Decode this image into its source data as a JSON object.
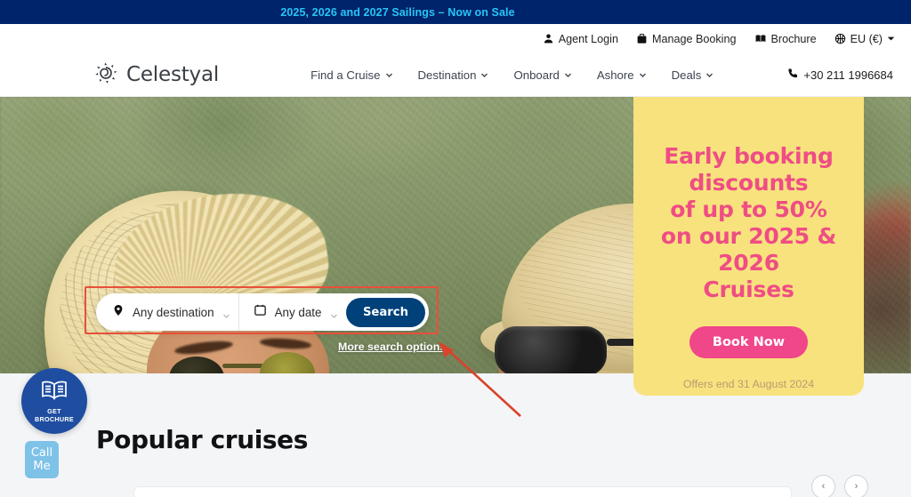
{
  "promo_banner": {
    "text": "2025, 2026 and 2027 Sailings – Now on Sale",
    "bg_color": "#00246b",
    "text_color": "#29c5f6"
  },
  "utility_bar": {
    "items": [
      {
        "label": "Agent Login",
        "icon": "user-icon"
      },
      {
        "label": "Manage Booking",
        "icon": "suitcase-icon"
      },
      {
        "label": "Brochure",
        "icon": "book-icon"
      },
      {
        "label": "EU (€)",
        "icon": "globe-icon"
      }
    ]
  },
  "header": {
    "logo_text": "Celestyal",
    "logo_icon": "sun-swirl-icon",
    "nav": [
      {
        "label": "Find a Cruise"
      },
      {
        "label": "Destination"
      },
      {
        "label": "Onboard"
      },
      {
        "label": "Ashore"
      },
      {
        "label": "Deals"
      }
    ],
    "phone": "+30 211 1996684",
    "phone_icon": "phone-icon"
  },
  "hero": {
    "search": {
      "destination_value": "Any destination",
      "destination_icon": "map-pin-icon",
      "date_value": "Any date",
      "date_icon": "calendar-icon",
      "search_button": "Search",
      "more_options": "More search options"
    },
    "promo_panel": {
      "heading_line1": "Early booking",
      "heading_line2": "discounts",
      "heading_line3": "of up to 50%",
      "heading_line4": "on our 2025 & 2026",
      "heading_line5": "Cruises",
      "button": "Book Now",
      "note": "Offers end 31 August 2024",
      "bg_color": "#f7e27e",
      "heading_color": "#ef4d84",
      "button_color": "#f0468a"
    }
  },
  "floating": {
    "brochure": {
      "line1": "GET",
      "line2": "BROCHURE",
      "icon": "open-book-icon",
      "bg_color": "#1f4ea1"
    },
    "call_me": {
      "line1": "Call",
      "line2": "Me",
      "bg_color": "#7ec2e8"
    }
  },
  "main": {
    "section_title": "Popular cruises",
    "carousel_prev": "‹",
    "carousel_next": "›"
  },
  "annotations": {
    "rect_color": "#e8503a",
    "arrow_color": "#d9432b"
  }
}
